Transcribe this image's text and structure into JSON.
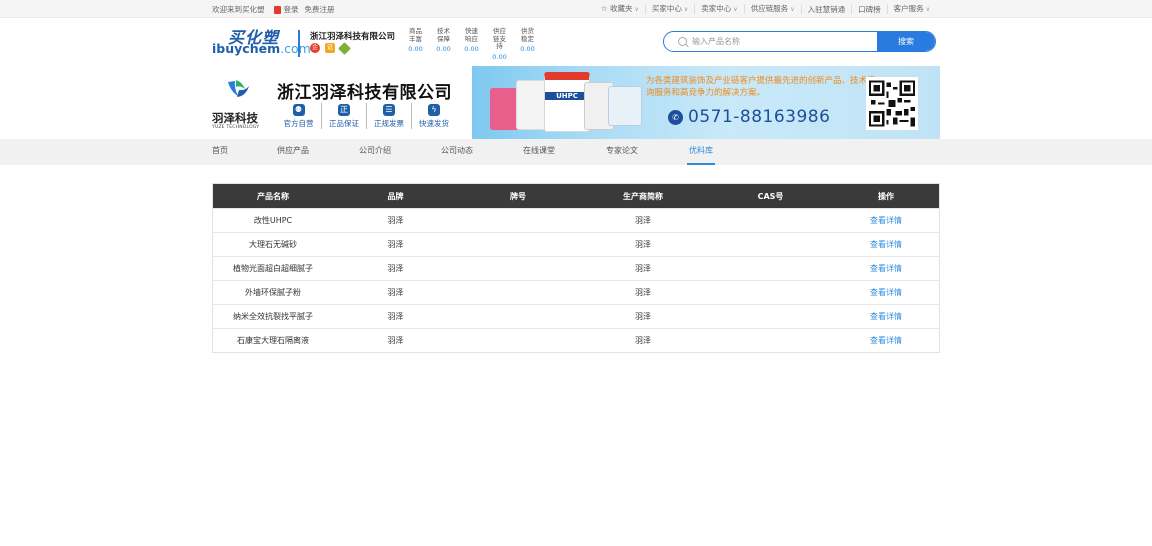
{
  "topbar": {
    "welcome": "欢迎来到买化塑",
    "login": "登录",
    "register": "免费注册",
    "links": [
      {
        "label": "☆ 收藏夹",
        "chevron": true
      },
      {
        "label": "买家中心",
        "chevron": true
      },
      {
        "label": "卖家中心",
        "chevron": true
      },
      {
        "label": "供应链服务",
        "chevron": true
      },
      {
        "label": "入驻慧销通",
        "chevron": false
      },
      {
        "label": "口碑榜",
        "chevron": false
      },
      {
        "label": "客户服务",
        "chevron": true
      }
    ]
  },
  "header": {
    "brand_cn": "买化塑",
    "brand_en_main": "ibuychem",
    "brand_en_tail": ".com",
    "shop_name": "浙江羽泽科技有限公司",
    "metrics": [
      {
        "label": "商品丰富",
        "value": "0.00"
      },
      {
        "label": "技术保障",
        "value": "0.00"
      },
      {
        "label": "快速响应",
        "value": "0.00"
      },
      {
        "label": "供应链支持",
        "value": "0.00"
      },
      {
        "label": "供货稳定",
        "value": "0.00"
      }
    ],
    "search": {
      "placeholder": "输入产品名称",
      "button": "搜索"
    }
  },
  "company": {
    "logo_cn": "羽泽科技",
    "logo_en": "YUZE TECHNOLOGY",
    "title": "浙江羽泽科技有限公司",
    "features": [
      {
        "icon": "person-icon",
        "glyph": "⚉",
        "label": "官方自营"
      },
      {
        "icon": "genuine-icon",
        "glyph": "正",
        "label": "正品保证"
      },
      {
        "icon": "invoice-icon",
        "glyph": "☰",
        "label": "正规发票"
      },
      {
        "icon": "lightning-icon",
        "glyph": "ϟ",
        "label": "快速发货"
      }
    ]
  },
  "banner": {
    "slogan": "为各类建筑装饰及产业链客户提供最先进的创新产品、技术咨询服务和高竞争力的解决方案。",
    "phone": "0571-88163986",
    "product_label": "UHPC"
  },
  "nav": {
    "items": [
      {
        "label": "首页",
        "active": false
      },
      {
        "label": "供应产品",
        "active": false
      },
      {
        "label": "公司介绍",
        "active": false
      },
      {
        "label": "公司动态",
        "active": false
      },
      {
        "label": "在线课堂",
        "active": false
      },
      {
        "label": "专家论文",
        "active": false
      },
      {
        "label": "优料库",
        "active": true
      }
    ]
  },
  "table": {
    "headers": [
      "产品名称",
      "品牌",
      "牌号",
      "生产商简称",
      "CAS号",
      "操作"
    ],
    "rows": [
      {
        "name": "改性UHPC",
        "brand": "羽泽",
        "grade": "",
        "maker": "羽泽",
        "cas": "",
        "action": "查看详情"
      },
      {
        "name": "大理石无碱砂",
        "brand": "羽泽",
        "grade": "",
        "maker": "羽泽",
        "cas": "",
        "action": "查看详情"
      },
      {
        "name": "植物光面超白超细腻子",
        "brand": "羽泽",
        "grade": "",
        "maker": "羽泽",
        "cas": "",
        "action": "查看详情"
      },
      {
        "name": "外墙环保腻子粉",
        "brand": "羽泽",
        "grade": "",
        "maker": "羽泽",
        "cas": "",
        "action": "查看详情"
      },
      {
        "name": "纳米全效抗裂找平腻子",
        "brand": "羽泽",
        "grade": "",
        "maker": "羽泽",
        "cas": "",
        "action": "查看详情"
      },
      {
        "name": "石康宝大理石隔离液",
        "brand": "羽泽",
        "grade": "",
        "maker": "羽泽",
        "cas": "",
        "action": "查看详情"
      }
    ]
  },
  "colors": {
    "accent": "#2a8de0",
    "brand_blue": "#1f5fa8",
    "table_header": "#3a3a3a",
    "slogan": "#f08a1c"
  }
}
